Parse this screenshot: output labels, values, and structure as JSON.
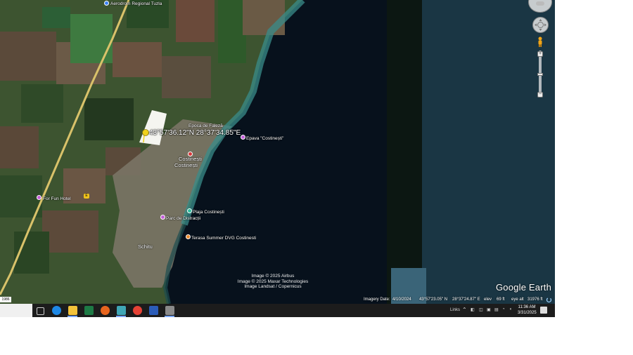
{
  "map": {
    "labels": {
      "aerodrom": "Aerodrom Regional Tuzla",
      "epava": "Epava \"Costinești\"",
      "costinesti_1": "Costinești",
      "costinesti_2": "Costinești",
      "epoca_faleza": "Epoca de Faleză",
      "plaja": "Plaja Costinești",
      "parc": "Parc de Distracții",
      "terasa": "Terasa Summer DVG Costinesti",
      "schitu": "Schitu",
      "forfun": "For Fun Hotel",
      "road_number": "E"
    },
    "placemark_coordinates": "43°57'36.12\"N  28°37'34.85\"E",
    "credits": [
      "Image © 2025 Airbus",
      "Image © 2025 Maxar Technologies",
      "Image Landsat / Copernicus"
    ],
    "logo": "Google Earth",
    "scale_text": "1986"
  },
  "status": {
    "imagery_label": "Imagery Date:",
    "imagery_date": "4/10/2024",
    "lat": "43°57'23.05\" N",
    "lon": "28°37'24.87\" E",
    "elev_label": "elev",
    "elev": "69 ft",
    "eye_label": "eye alt",
    "eye": "31976 ft"
  },
  "taskbar": {
    "links_label": "Links",
    "time": "11:36 AM",
    "date": "3/31/2025",
    "apps": [
      "task-view-icon",
      "edge-icon",
      "file-explorer-icon",
      "excel-icon",
      "firefox-icon",
      "app-icon",
      "chrome-icon",
      "word-icon",
      "google-earth-icon"
    ]
  },
  "colors": {
    "sea": "#0b1522",
    "sea_light": "#1f3d4d",
    "land": "#3f5a31",
    "taskbar": "#1c1c1c",
    "pin_yellow": "#f0d21b"
  }
}
